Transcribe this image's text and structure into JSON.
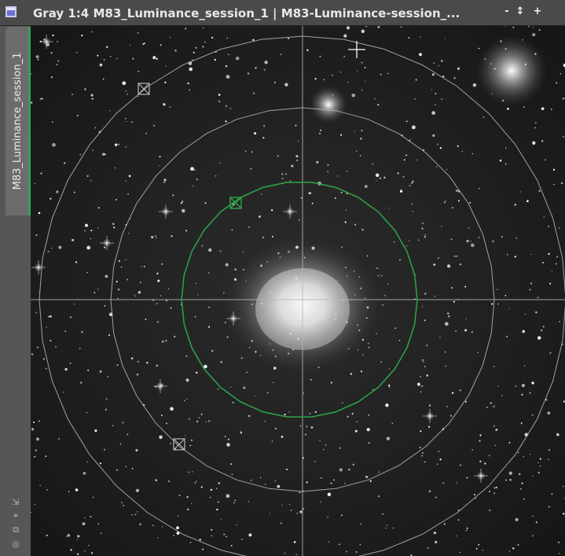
{
  "window": {
    "title": "Gray 1:4 M83_Luminance_session_1 | M83-Luminance-session_...",
    "icon": "image-window-icon",
    "buttons": [
      {
        "name": "shade-button",
        "glyph": "-"
      },
      {
        "name": "maximize-button",
        "glyph": "↕"
      },
      {
        "name": "close-button",
        "glyph": "+"
      }
    ]
  },
  "view_tab": {
    "label": "M83_Luminance_session_1",
    "accent_color": "#2fa35c"
  },
  "sidebar_tools": [
    {
      "name": "resize-icon",
      "glyph": "⇲"
    },
    {
      "name": "fit-view-icon",
      "glyph": "⌖"
    },
    {
      "name": "clone-view-icon",
      "glyph": "⧉"
    },
    {
      "name": "target-icon",
      "glyph": "◎"
    }
  ],
  "overlay": {
    "inner_circle_color": "#2e9e4a",
    "grid_color": "#b8b8b8",
    "crosshair_cursor": "crosshair-cursor",
    "handles": [
      "upper-left-handle",
      "lower-left-handle",
      "inner-circle-handle"
    ]
  },
  "image": {
    "object": "M83",
    "mode": "Gray",
    "zoom": "1:4"
  }
}
